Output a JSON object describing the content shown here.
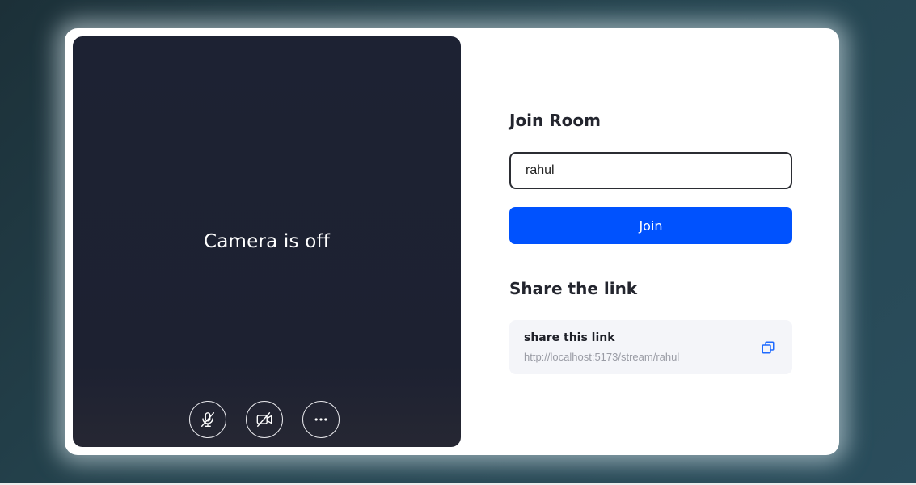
{
  "video": {
    "camera_off_text": "Camera is off",
    "controls": [
      {
        "icon": "mic-off-icon"
      },
      {
        "icon": "video-off-icon"
      },
      {
        "icon": "more-horizontal-icon"
      }
    ]
  },
  "join": {
    "title": "Join Room",
    "input_value": "rahul",
    "button_label": "Join"
  },
  "share": {
    "title": "Share the link",
    "label": "share this link",
    "url": "http://localhost:5173/stream/rahul",
    "copy_icon": "copy-icon"
  },
  "colors": {
    "accent": "#0052fe",
    "video_bg": "#1d2233",
    "share_bg": "#f4f5f9"
  }
}
